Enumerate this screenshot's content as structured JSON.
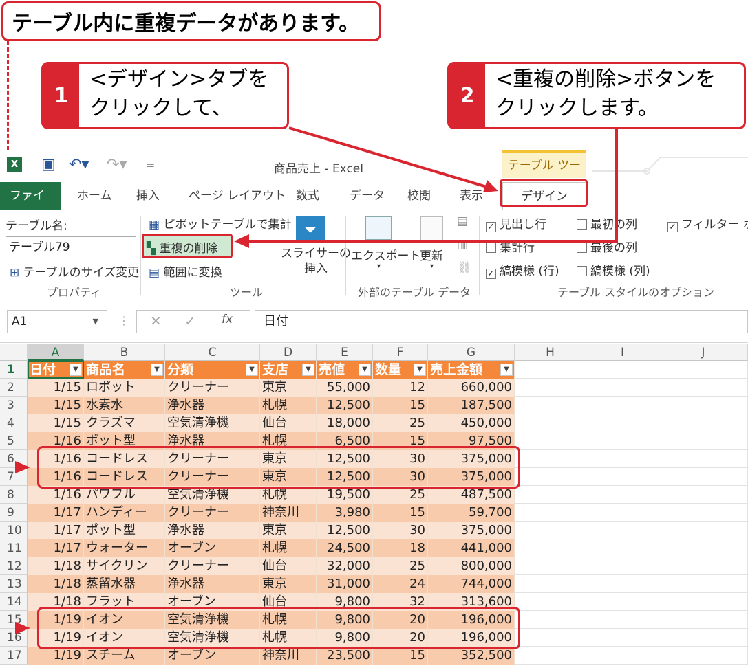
{
  "callouts": {
    "top": "テーブル内に重複データがあります。",
    "step1": {
      "num": "1",
      "line1": "<デザイン>タブを",
      "line2": "クリックして、"
    },
    "step2": {
      "num": "2",
      "line1": "<重複の削除>ボタンを",
      "line2": "クリックします。"
    }
  },
  "window": {
    "title": "商品売上 - Excel",
    "tool_context": "テーブル ツール"
  },
  "tabs": [
    "ファイル",
    "ホーム",
    "挿入",
    "ページ レイアウト",
    "数式",
    "データ",
    "校閲",
    "表示",
    "デザイン"
  ],
  "ribbon": {
    "table_name_label": "テーブル名:",
    "table_name_value": "テーブル79",
    "resize": "テーブルのサイズ変更",
    "group_properties": "プロパティ",
    "pivot": "ピボットテーブルで集計",
    "remove_dup": "重複の削除",
    "convert_range": "範囲に変換",
    "slicer1": "スライサーの",
    "slicer2": "挿入",
    "group_tools": "ツール",
    "export": "エクスポート",
    "refresh": "更新",
    "group_external": "外部のテーブル データ",
    "opt_header": "見出し行",
    "opt_total": "集計行",
    "opt_banded_rows": "縞模様 (行)",
    "opt_first_col": "最初の列",
    "opt_last_col": "最後の列",
    "opt_banded_cols": "縞模様 (列)",
    "opt_filter": "フィルター ボタ",
    "group_style_opts": "テーブル スタイルのオプション"
  },
  "formula_bar": {
    "cell_ref": "A1",
    "fx": "fx",
    "value": "日付"
  },
  "columns": [
    "A",
    "B",
    "C",
    "D",
    "E",
    "F",
    "G",
    "H",
    "I",
    "J"
  ],
  "headers": [
    "日付",
    "商品名",
    "分類",
    "支店",
    "売値",
    "数量",
    "売上金額"
  ],
  "rows": [
    [
      "1/15",
      "ロボット",
      "クリーナー",
      "東京",
      "55,000",
      "12",
      "660,000"
    ],
    [
      "1/15",
      "水素水",
      "浄水器",
      "札幌",
      "12,500",
      "15",
      "187,500"
    ],
    [
      "1/15",
      "クラズマ",
      "空気清浄機",
      "仙台",
      "18,000",
      "25",
      "450,000"
    ],
    [
      "1/16",
      "ポット型",
      "浄水器",
      "札幌",
      "6,500",
      "15",
      "97,500"
    ],
    [
      "1/16",
      "コードレス",
      "クリーナー",
      "東京",
      "12,500",
      "30",
      "375,000"
    ],
    [
      "1/16",
      "コードレス",
      "クリーナー",
      "東京",
      "12,500",
      "30",
      "375,000"
    ],
    [
      "1/16",
      "パワフル",
      "空気清浄機",
      "札幌",
      "19,500",
      "25",
      "487,500"
    ],
    [
      "1/17",
      "ハンディー",
      "クリーナー",
      "神奈川",
      "3,980",
      "15",
      "59,700"
    ],
    [
      "1/17",
      "ポット型",
      "浄水器",
      "東京",
      "12,500",
      "30",
      "375,000"
    ],
    [
      "1/17",
      "ウォーター",
      "オーブン",
      "札幌",
      "24,500",
      "18",
      "441,000"
    ],
    [
      "1/18",
      "サイクリン",
      "クリーナー",
      "仙台",
      "32,000",
      "25",
      "800,000"
    ],
    [
      "1/18",
      "蒸留水器",
      "浄水器",
      "東京",
      "31,000",
      "24",
      "744,000"
    ],
    [
      "1/18",
      "フラット",
      "オーブン",
      "仙台",
      "9,800",
      "32",
      "313,600"
    ],
    [
      "1/19",
      "イオン",
      "空気清浄機",
      "札幌",
      "9,800",
      "20",
      "196,000"
    ],
    [
      "1/19",
      "イオン",
      "空気清浄機",
      "札幌",
      "9,800",
      "20",
      "196,000"
    ],
    [
      "1/19",
      "スチーム",
      "オーブン",
      "神奈川",
      "23,500",
      "15",
      "352,500"
    ]
  ],
  "row_numbers": [
    "1",
    "2",
    "3",
    "4",
    "5",
    "6",
    "7",
    "8",
    "9",
    "10",
    "11",
    "12",
    "13",
    "14",
    "15",
    "16",
    "17"
  ]
}
